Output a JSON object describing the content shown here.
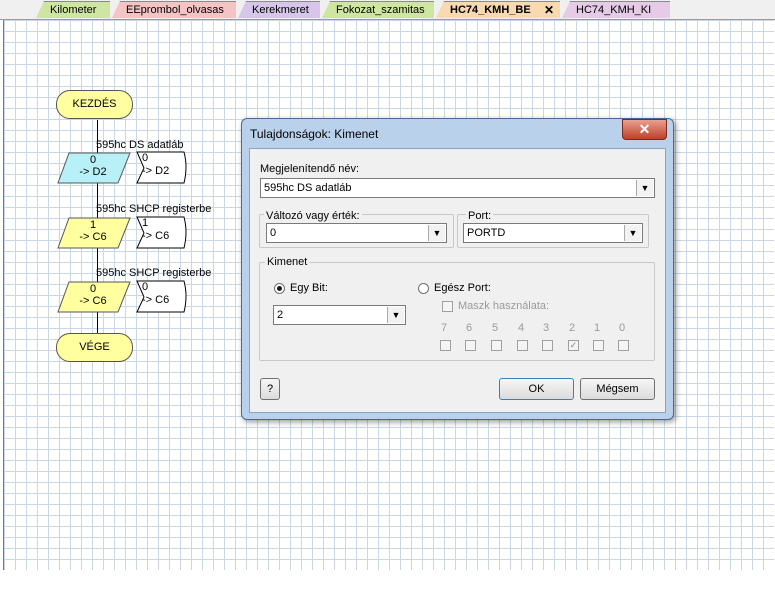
{
  "tabs": [
    {
      "label": "Kilometer",
      "color": "#cfe6a3"
    },
    {
      "label": "EEprombol_olvasas",
      "color": "#f4c3c3"
    },
    {
      "label": "Kerekmeret",
      "color": "#d8c6ea"
    },
    {
      "label": "Fokozat_szamitas",
      "color": "#cfe6a3"
    },
    {
      "label": "HC74_KMH_BE",
      "color": "#f8d9b0"
    },
    {
      "label": "HC74_KMH_KI",
      "color": "#e6cbe6"
    }
  ],
  "active_tab_close": "✕",
  "flowchart": {
    "start_label": "KEZDÉS",
    "end_label": "VÉGE",
    "blocks": [
      {
        "caption": "595hc DS adatláb",
        "value": "0",
        "target": "-> D2",
        "note_value": "0",
        "note_target": "-> D2",
        "fill": "#b8f0f8"
      },
      {
        "caption": "595hc SHCP registerbe",
        "value": "1",
        "target": "-> C6",
        "note_value": "1",
        "note_target": "-> C6",
        "fill": "#ffffa0"
      },
      {
        "caption": "595hc SHCP registerbe",
        "value": "0",
        "target": "-> C6",
        "note_value": "0",
        "note_target": "-> C6",
        "fill": "#ffffa0"
      }
    ]
  },
  "dialog": {
    "title": "Tulajdonságok: Kimenet",
    "close_label": "✕",
    "name_label": "Megjelenítendő név:",
    "name_value": "595hc DS adatláb",
    "var_label": "Változó vagy érték:",
    "var_value": "0",
    "port_label": "Port:",
    "port_value": "PORTD",
    "output_group_label": "Kimenet",
    "radio_bit_label": "Egy Bit:",
    "radio_port_label": "Egész Port:",
    "bit_value": "2",
    "mask_label": "Maszk használata:",
    "bits": [
      "7",
      "6",
      "5",
      "4",
      "3",
      "2",
      "1",
      "0"
    ],
    "bits_checked": [
      false,
      false,
      false,
      false,
      false,
      true,
      false,
      false
    ],
    "help_label": "?",
    "ok_label": "OK",
    "cancel_label": "Mégsem",
    "arrow_glyph": "▼"
  }
}
